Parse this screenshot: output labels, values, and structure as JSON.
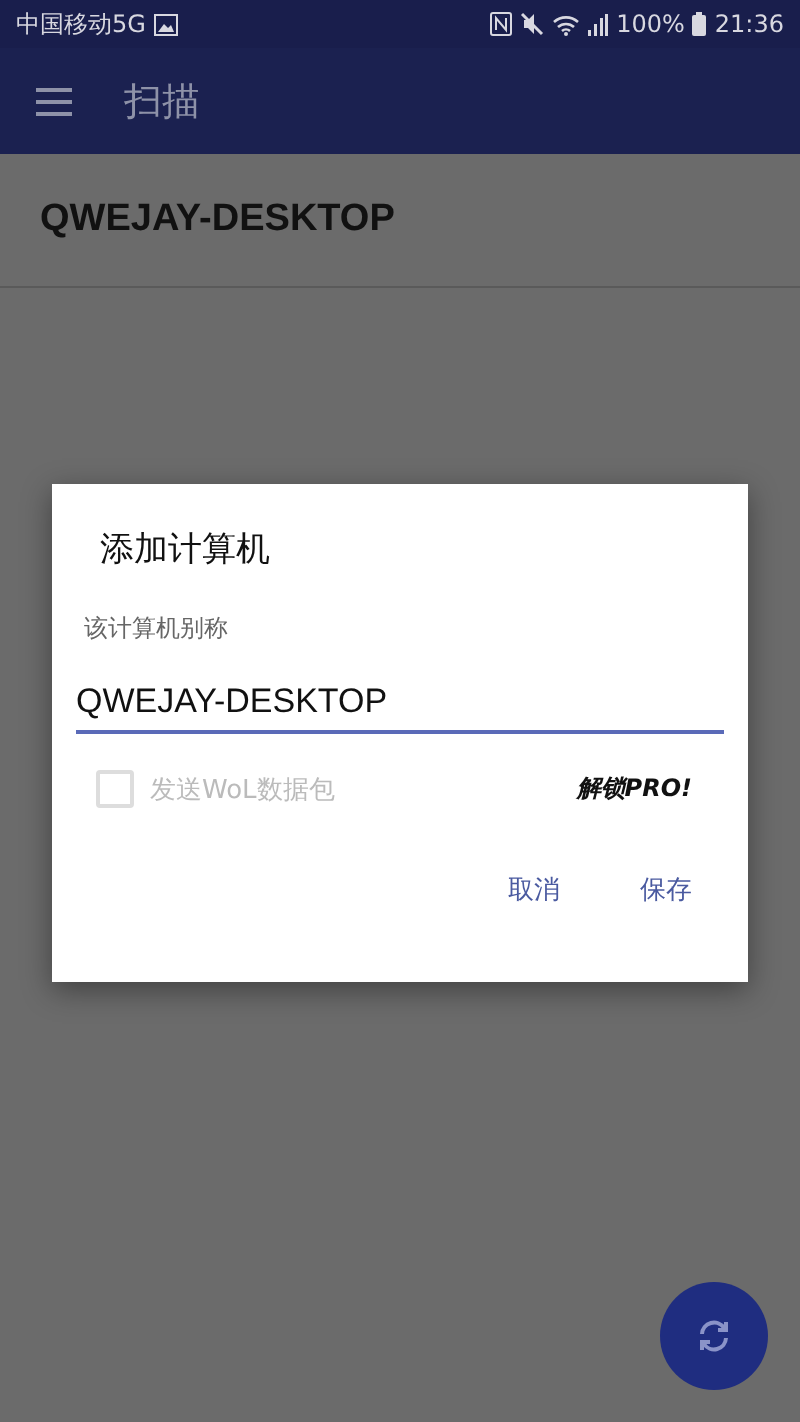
{
  "status_bar": {
    "carrier": "中国移动5G",
    "battery": "100%",
    "time": "21:36"
  },
  "app_bar": {
    "title": "扫描"
  },
  "list": [
    {
      "name": "QWEJAY-DESKTOP"
    }
  ],
  "dialog": {
    "title": "添加计算机",
    "field_label": "该计算机别称",
    "field_value": "QWEJAY-DESKTOP",
    "checkbox": {
      "label": "发送WoL数据包",
      "checked": false,
      "disabled": true
    },
    "unlock": "解锁PRO!",
    "buttons": [
      {
        "label": "取消"
      },
      {
        "label": "保存"
      }
    ]
  }
}
